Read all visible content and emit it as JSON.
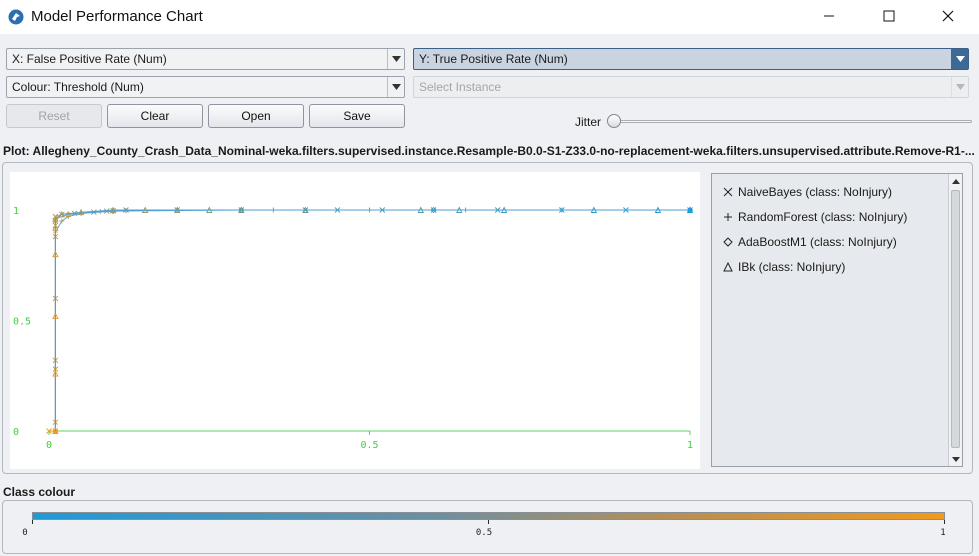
{
  "window": {
    "title": "Model Performance Chart",
    "app_icon": "weka-bird-icon",
    "controls": [
      "minimize-icon",
      "maximize-icon",
      "close-icon"
    ]
  },
  "controls": {
    "x_axis": {
      "selected": "X: False Positive Rate (Num)"
    },
    "y_axis": {
      "selected": "Y: True Positive Rate (Num)"
    },
    "colour": {
      "selected": "Colour: Threshold (Num)"
    },
    "select_instance": {
      "selected": "Select Instance",
      "disabled": true
    },
    "buttons": {
      "reset": "Reset",
      "clear": "Clear",
      "open": "Open",
      "save": "Save"
    },
    "jitter": {
      "label": "Jitter",
      "value": 0
    }
  },
  "plot": {
    "title": "Plot: Allegheny_County_Crash_Data_Nominal-weka.filters.supervised.instance.Resample-B0.0-S1-Z33.0-no-replacement-weka.filters.unsupervised.attribute.Remove-R1-...",
    "x_ticks": [
      "0",
      "0.5",
      "1"
    ],
    "y_ticks": [
      "0",
      "0.5",
      "1"
    ]
  },
  "legend": {
    "items": [
      {
        "label": "NaiveBayes (class: NoInjury)",
        "symbol": "x"
      },
      {
        "label": "RandomForest (class: NoInjury)",
        "symbol": "+"
      },
      {
        "label": "AdaBoostM1 (class: NoInjury)",
        "symbol": "diamond"
      },
      {
        "label": "IBk (class: NoInjury)",
        "symbol": "triangle"
      }
    ]
  },
  "class_colour": {
    "label": "Class colour",
    "ticks": [
      "0",
      "0.5",
      "1"
    ],
    "colors": {
      "low": "#1f9ad8",
      "high": "#f19a1c"
    }
  },
  "chart_data": {
    "type": "scatter",
    "title": "Plot: Allegheny_County_Crash_Data_Nominal-weka.filters.supervised.instance.Resample-B0.0-S1-Z33.0-no-replacement-weka.filters.unsupervised.attribute.Remove-R1-...",
    "xlabel": "False Positive Rate",
    "ylabel": "True Positive Rate",
    "xlim": [
      0,
      1
    ],
    "ylim": [
      0,
      1
    ],
    "x_ticks": [
      0,
      0.5,
      1
    ],
    "y_ticks": [
      0,
      0.5,
      1
    ],
    "color_by": "Threshold",
    "series": [
      {
        "name": "NaiveBayes (class: NoInjury)",
        "marker": "x",
        "points": [
          [
            0,
            0
          ],
          [
            0.01,
            0
          ],
          [
            0.01,
            0.04
          ],
          [
            0.01,
            0.28
          ],
          [
            0.01,
            0.32
          ],
          [
            0.01,
            0.6
          ],
          [
            0.01,
            0.88
          ],
          [
            0.01,
            0.93
          ],
          [
            0.01,
            0.95
          ],
          [
            0.01,
            0.97
          ],
          [
            0.02,
            0.98
          ],
          [
            0.04,
            0.985
          ],
          [
            0.07,
            0.99
          ],
          [
            0.09,
            0.995
          ],
          [
            0.1,
            0.997
          ],
          [
            0.12,
            1
          ],
          [
            0.2,
            1
          ],
          [
            0.3,
            1
          ],
          [
            0.4,
            1
          ],
          [
            0.45,
            1
          ],
          [
            0.52,
            1
          ],
          [
            0.6,
            1
          ],
          [
            0.7,
            1
          ],
          [
            0.8,
            1
          ],
          [
            0.9,
            1
          ],
          [
            1,
            1
          ]
        ]
      },
      {
        "name": "RandomForest (class: NoInjury)",
        "marker": "+",
        "points": [
          [
            0.01,
            0
          ],
          [
            0.01,
            0.9
          ],
          [
            0.02,
            0.95
          ],
          [
            0.03,
            0.97
          ],
          [
            0.05,
            0.985
          ],
          [
            0.08,
            0.993
          ],
          [
            0.12,
            0.997
          ],
          [
            0.2,
            1
          ],
          [
            0.35,
            1
          ],
          [
            0.5,
            1
          ],
          [
            0.65,
            1
          ],
          [
            0.8,
            1
          ],
          [
            1,
            1
          ]
        ]
      },
      {
        "name": "AdaBoostM1 (class: NoInjury)",
        "marker": "diamond",
        "points": [
          [
            0.01,
            0
          ],
          [
            0.01,
            0.96
          ],
          [
            0.03,
            0.98
          ],
          [
            0.1,
            0.995
          ],
          [
            0.3,
            1
          ],
          [
            0.6,
            1
          ],
          [
            1,
            1
          ]
        ]
      },
      {
        "name": "IBk (class: NoInjury)",
        "marker": "triangle",
        "points": [
          [
            0.01,
            0
          ],
          [
            0.01,
            0.26
          ],
          [
            0.01,
            0.52
          ],
          [
            0.01,
            0.8
          ],
          [
            0.01,
            0.92
          ],
          [
            0.01,
            0.96
          ],
          [
            0.02,
            0.98
          ],
          [
            0.05,
            0.99
          ],
          [
            0.1,
            1
          ],
          [
            0.15,
            1
          ],
          [
            0.2,
            1
          ],
          [
            0.25,
            1
          ],
          [
            0.3,
            1
          ],
          [
            0.4,
            1
          ],
          [
            0.58,
            1
          ],
          [
            0.64,
            1
          ],
          [
            0.71,
            1
          ],
          [
            0.85,
            1
          ],
          [
            0.95,
            1
          ],
          [
            1,
            1
          ]
        ]
      }
    ]
  }
}
